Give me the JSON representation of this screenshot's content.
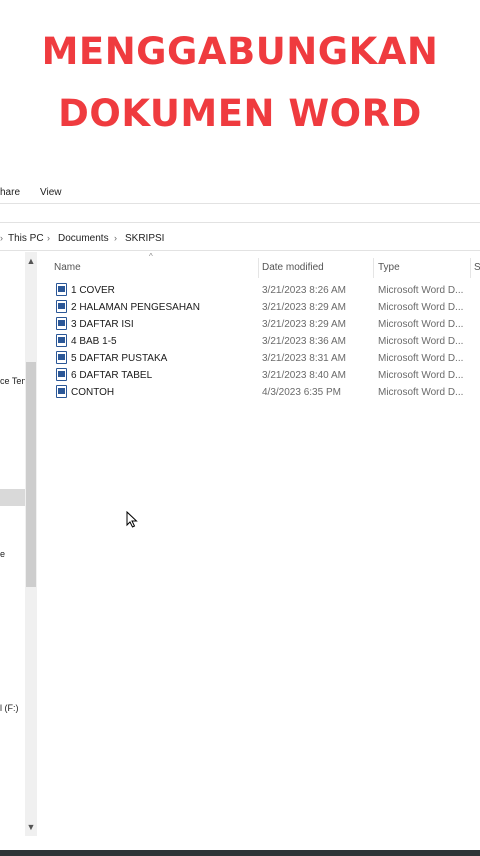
{
  "headline": {
    "line1": "MENGGABUNGKAN",
    "line2": "DOKUMEN WORD"
  },
  "ribbon": {
    "tab_share": "hare",
    "tab_view": "View"
  },
  "breadcrumb": {
    "items": [
      "This PC",
      "Documents",
      "SKRIPSI"
    ],
    "separator": "›"
  },
  "nav_pane": {
    "item1": "ce Ten",
    "item2": "e",
    "item3": "l (F:)"
  },
  "columns": {
    "name": "Name",
    "date": "Date modified",
    "type": "Type",
    "size": "S"
  },
  "files": [
    {
      "name": "1 COVER",
      "date": "3/21/2023 8:26 AM",
      "type": "Microsoft Word D..."
    },
    {
      "name": "2 HALAMAN PENGESAHAN",
      "date": "3/21/2023 8:29 AM",
      "type": "Microsoft Word D..."
    },
    {
      "name": "3 DAFTAR ISI",
      "date": "3/21/2023 8:29 AM",
      "type": "Microsoft Word D..."
    },
    {
      "name": "4 BAB 1-5",
      "date": "3/21/2023 8:36 AM",
      "type": "Microsoft Word D..."
    },
    {
      "name": "5 DAFTAR PUSTAKA",
      "date": "3/21/2023 8:31 AM",
      "type": "Microsoft Word D..."
    },
    {
      "name": "6 DAFTAR TABEL",
      "date": "3/21/2023 8:40 AM",
      "type": "Microsoft Word D..."
    },
    {
      "name": "CONTOH",
      "date": "4/3/2023 6:35 PM",
      "type": "Microsoft Word D..."
    }
  ],
  "icons": {
    "file": "word-document-icon",
    "cursor": "mouse-pointer-icon"
  },
  "colors": {
    "headline": "#ef3b3f",
    "word_blue": "#2b5797"
  }
}
